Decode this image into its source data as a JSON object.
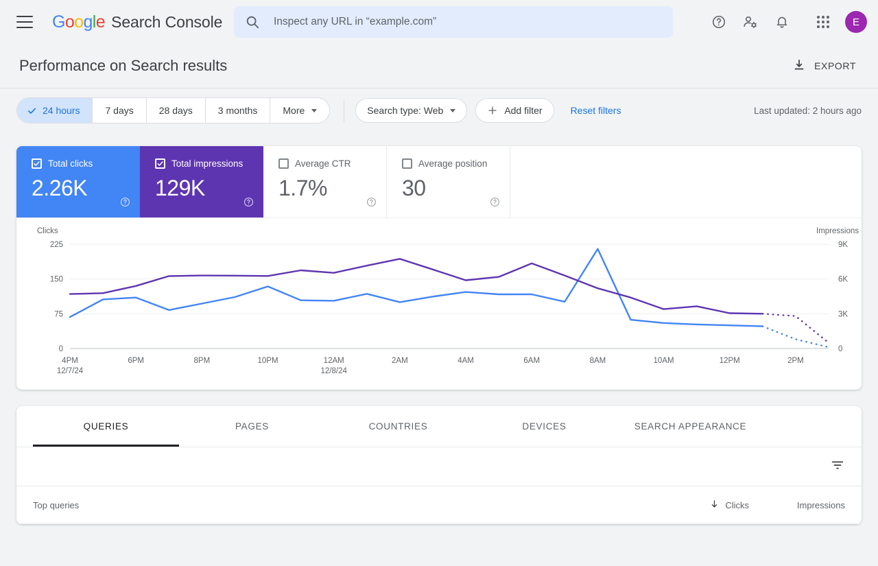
{
  "header": {
    "menu_icon": "hamburger-icon",
    "logo_letters": [
      "G",
      "o",
      "o",
      "g",
      "l",
      "e"
    ],
    "product": "Search Console",
    "search": {
      "icon": "search-icon",
      "placeholder": "Inspect any URL in “example.com”",
      "value": ""
    },
    "actions": [
      {
        "name": "help-icon",
        "label": "Help"
      },
      {
        "name": "account-settings-icon",
        "label": "Account settings"
      },
      {
        "name": "notifications-bell-icon",
        "label": "Notifications"
      },
      {
        "name": "apps-grid-icon",
        "label": "Google apps"
      }
    ],
    "avatar_letter": "E",
    "avatar_color": "#9C27B0"
  },
  "title_bar": {
    "title": "Performance on Search results",
    "export_label": "EXPORT",
    "export_icon": "download-icon"
  },
  "filter_bar": {
    "date_ranges": [
      {
        "label": "24 hours",
        "active": true
      },
      {
        "label": "7 days",
        "active": false
      },
      {
        "label": "28 days",
        "active": false
      },
      {
        "label": "3 months",
        "active": false
      },
      {
        "label": "More",
        "active": false,
        "has_caret": true
      }
    ],
    "search_type": "Search type: Web",
    "add_filter": "Add filter",
    "reset_filters": "Reset filters",
    "last_updated": "Last updated: 2 hours ago"
  },
  "metrics": [
    {
      "label": "Total clicks",
      "value": "2.26K",
      "checked": true,
      "color": "#4285F4",
      "key": "clicks"
    },
    {
      "label": "Total impressions",
      "value": "129K",
      "checked": true,
      "color": "#5E35B1",
      "key": "impr"
    },
    {
      "label": "Average CTR",
      "value": "1.7%",
      "checked": false,
      "color": "#FFFFFF",
      "key": "ctr"
    },
    {
      "label": "Average position",
      "value": "30",
      "checked": false,
      "color": "#FFFFFF",
      "key": "pos"
    }
  ],
  "chart_data": {
    "type": "line",
    "title": "",
    "xlabel": "",
    "ylabel": "Clicks",
    "y2label": "Impressions",
    "grid": true,
    "legend": "none",
    "x": [
      "4PM",
      "5PM",
      "6PM",
      "7PM",
      "8PM",
      "9PM",
      "10PM",
      "11PM",
      "12AM",
      "1AM",
      "2AM",
      "3AM",
      "4AM",
      "5AM",
      "6AM",
      "7AM",
      "8AM",
      "9AM",
      "10AM",
      "11AM",
      "12PM",
      "1PM",
      "2PM",
      "3PM"
    ],
    "x_tick_labels": [
      {
        "pos": 0,
        "line1": "4PM",
        "line2": "12/7/24"
      },
      {
        "pos": 2,
        "line1": "6PM",
        "line2": ""
      },
      {
        "pos": 4,
        "line1": "8PM",
        "line2": ""
      },
      {
        "pos": 6,
        "line1": "10PM",
        "line2": ""
      },
      {
        "pos": 8,
        "line1": "12AM",
        "line2": "12/8/24"
      },
      {
        "pos": 10,
        "line1": "2AM",
        "line2": ""
      },
      {
        "pos": 12,
        "line1": "4AM",
        "line2": ""
      },
      {
        "pos": 14,
        "line1": "6AM",
        "line2": ""
      },
      {
        "pos": 16,
        "line1": "8AM",
        "line2": ""
      },
      {
        "pos": 18,
        "line1": "10AM",
        "line2": ""
      },
      {
        "pos": 20,
        "line1": "12PM",
        "line2": ""
      },
      {
        "pos": 22,
        "line1": "2PM",
        "line2": ""
      }
    ],
    "y_ticks": [
      0,
      75,
      150,
      225
    ],
    "ylim": [
      0,
      225
    ],
    "y2_ticks": [
      "0",
      "3K",
      "6K",
      "9K"
    ],
    "y2lim": [
      0,
      9000
    ],
    "series": [
      {
        "name": "Clicks",
        "axis": "left",
        "color": "#4285F4",
        "values": [
          68,
          106,
          110,
          83,
          97,
          111,
          134,
          104,
          103,
          118,
          100,
          112,
          122,
          117,
          117,
          101,
          215,
          62,
          55,
          52,
          50,
          48,
          20,
          3
        ],
        "dashed_from_index": 21
      },
      {
        "name": "Impressions",
        "axis": "right",
        "color": "#5E35B1",
        "values": [
          4700,
          4780,
          5400,
          6250,
          6300,
          6290,
          6260,
          6750,
          6530,
          7150,
          7740,
          6820,
          5890,
          6180,
          7350,
          6300,
          5200,
          4400,
          3400,
          3650,
          3050,
          3000,
          2800,
          500
        ],
        "dashed_from_index": 21
      }
    ]
  },
  "tabs": [
    {
      "label": "QUERIES",
      "active": true
    },
    {
      "label": "PAGES",
      "active": false
    },
    {
      "label": "COUNTRIES",
      "active": false
    },
    {
      "label": "DEVICES",
      "active": false
    },
    {
      "label": "SEARCH APPEARANCE",
      "active": false
    }
  ],
  "table": {
    "filter_icon": "filter-list-icon",
    "columns": {
      "queries": "Top queries",
      "clicks": "Clicks",
      "clicks_sort_icon": "sort-descending-arrow",
      "impressions": "Impressions"
    },
    "rows": []
  }
}
